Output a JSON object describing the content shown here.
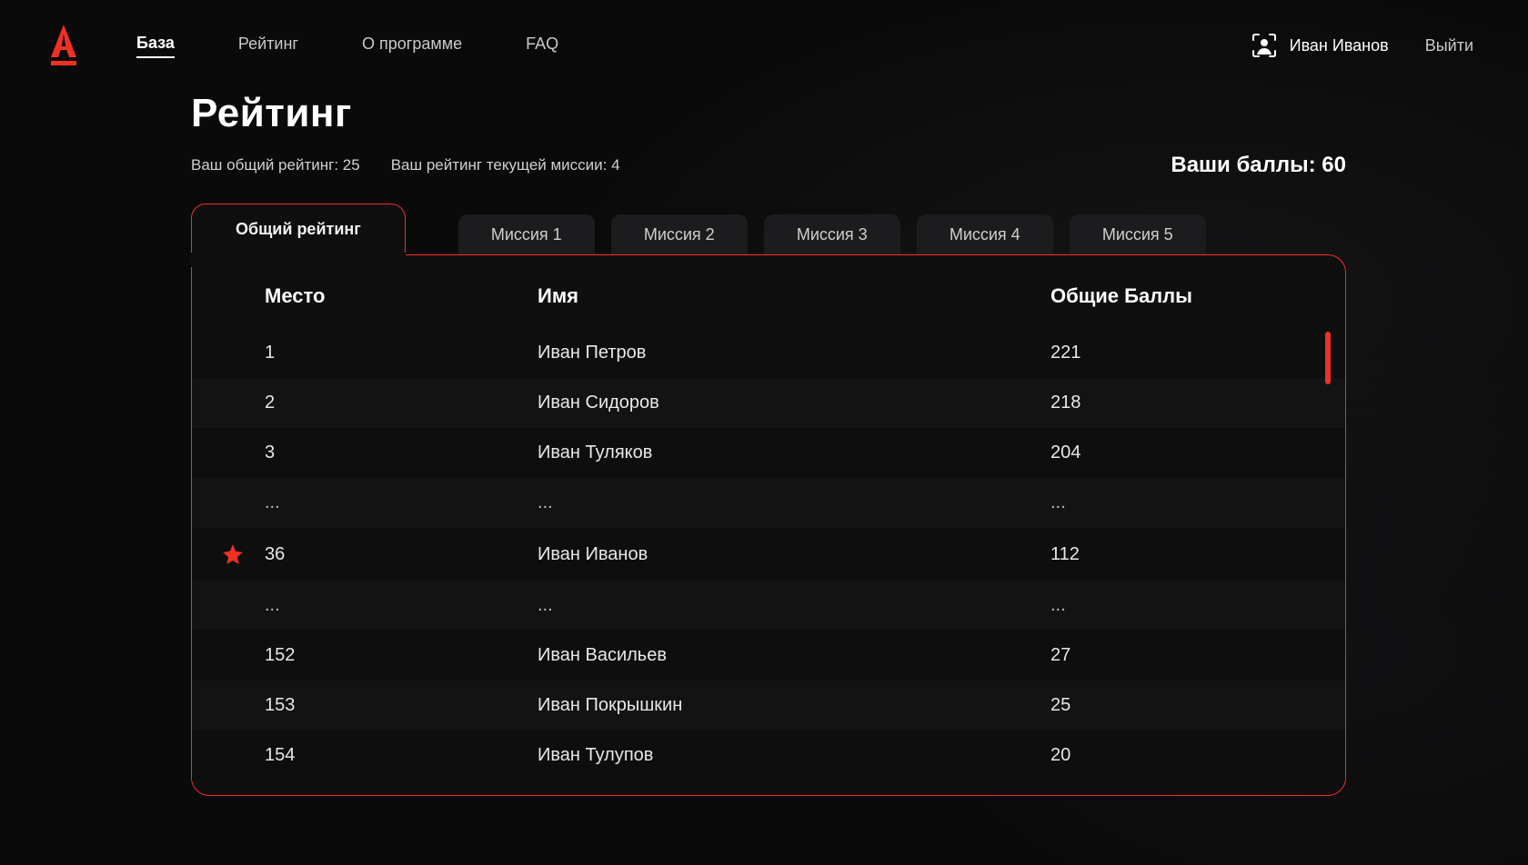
{
  "colors": {
    "accent": "#ef3124"
  },
  "nav": {
    "items": [
      {
        "label": "База",
        "active": true
      },
      {
        "label": "Рейтинг",
        "active": false
      },
      {
        "label": "О программе",
        "active": false
      },
      {
        "label": "FAQ",
        "active": false
      }
    ]
  },
  "user": {
    "name": "Иван Иванов"
  },
  "logout_label": "Выйти",
  "page": {
    "title": "Рейтинг",
    "overall_rating_label": "Ваш общий рейтинг: 25",
    "mission_rating_label": "Ваш рейтинг текущей миссии: 4",
    "points_label": "Ваши баллы: 60"
  },
  "tabs": {
    "items": [
      {
        "label": "Общий рейтинг",
        "active": true
      },
      {
        "label": "Миссия 1",
        "active": false
      },
      {
        "label": "Миссия 2",
        "active": false
      },
      {
        "label": "Миссия 3",
        "active": false
      },
      {
        "label": "Миссия 4",
        "active": false
      },
      {
        "label": "Миссия 5",
        "active": false
      }
    ]
  },
  "table": {
    "headers": {
      "place": "Место",
      "name": "Имя",
      "score": "Общие Баллы"
    },
    "rows": [
      {
        "place": "1",
        "name": "Иван Петров",
        "score": "221",
        "me": false
      },
      {
        "place": "2",
        "name": "Иван Сидоров",
        "score": "218",
        "me": false
      },
      {
        "place": "3",
        "name": "Иван Туляков",
        "score": "204",
        "me": false
      },
      {
        "place": "...",
        "name": "...",
        "score": "...",
        "me": false,
        "ellipsis": true
      },
      {
        "place": "36",
        "name": "Иван Иванов",
        "score": "112",
        "me": true
      },
      {
        "place": "...",
        "name": "...",
        "score": "...",
        "me": false,
        "ellipsis": true
      },
      {
        "place": "152",
        "name": "Иван Васильев",
        "score": "27",
        "me": false
      },
      {
        "place": "153",
        "name": "Иван Покрышкин",
        "score": "25",
        "me": false
      },
      {
        "place": "154",
        "name": "Иван Тулупов",
        "score": "20",
        "me": false
      }
    ]
  }
}
